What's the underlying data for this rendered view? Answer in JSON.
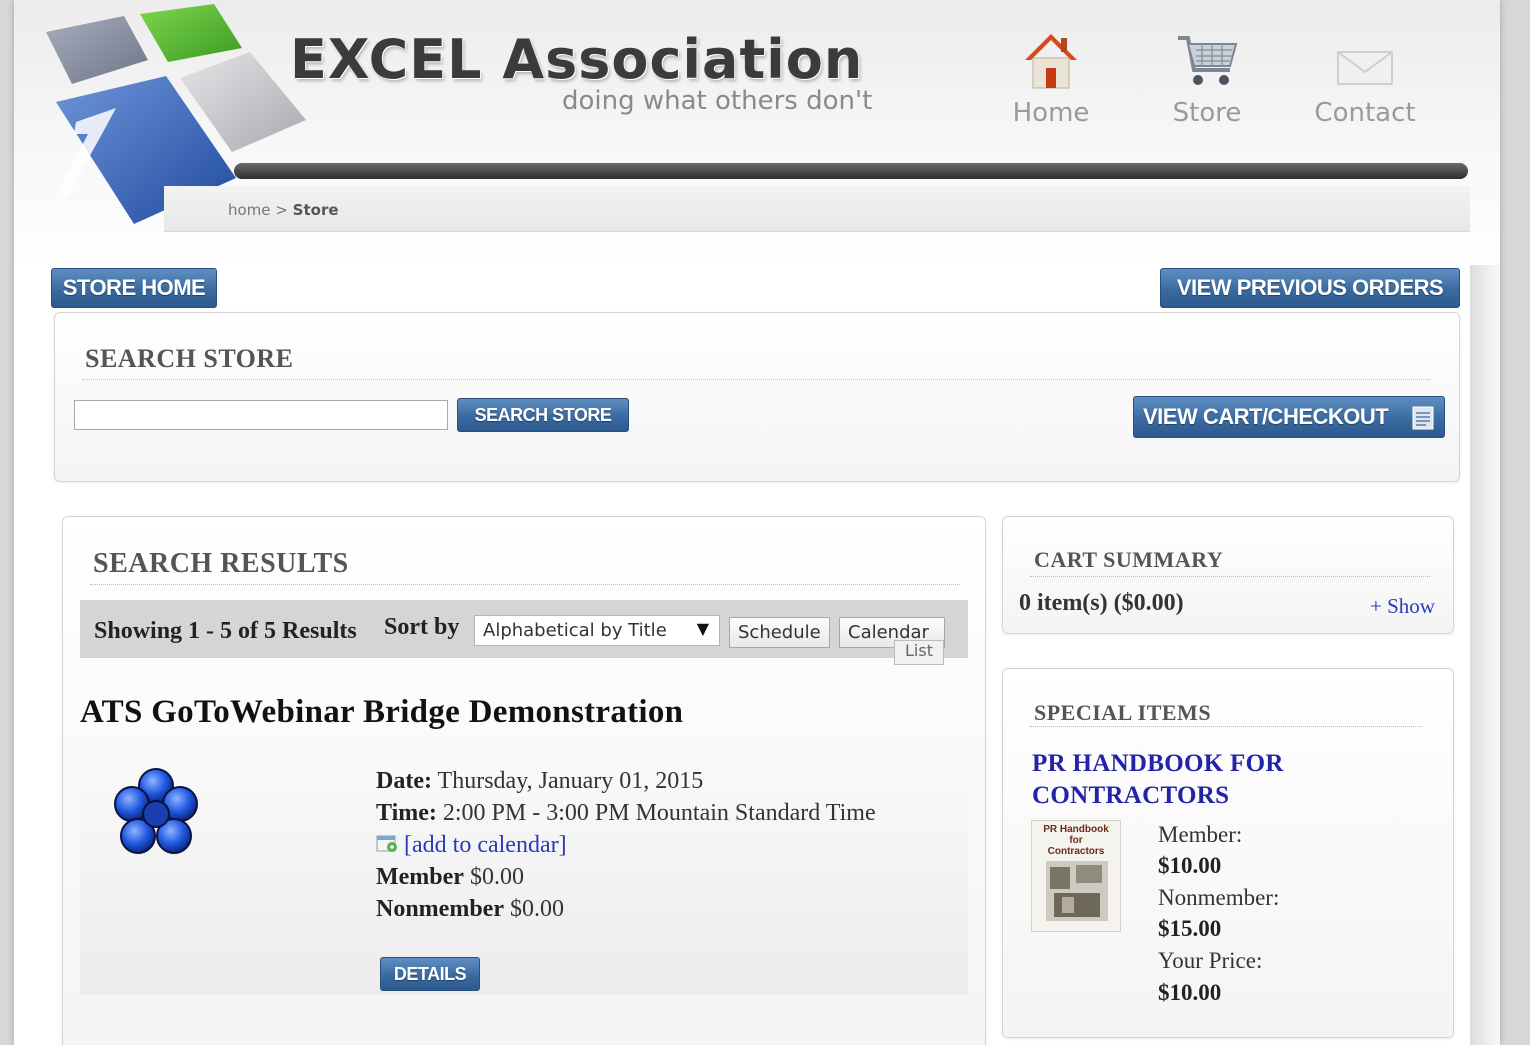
{
  "brand": {
    "name": "EXCEL Association",
    "tagline": "doing what others don't"
  },
  "nav": {
    "home": "Home",
    "store": "Store",
    "contact": "Contact"
  },
  "breadcrumb": {
    "home": "home",
    "separator": ">",
    "current": "Store"
  },
  "buttons": {
    "store_home": "STORE HOME",
    "view_previous_orders": "VIEW PREVIOUS ORDERS",
    "search_store": "SEARCH STORE",
    "view_cart": "VIEW CART/CHECKOUT",
    "details": "DETAILS"
  },
  "search": {
    "title": "SEARCH STORE",
    "value": "",
    "placeholder": ""
  },
  "results": {
    "title": "SEARCH RESULTS",
    "showing": "Showing 1 - 5 of 5 Results",
    "sort_label": "Sort by",
    "sort_selected": "Alphabetical by Title",
    "view_schedule": "Schedule",
    "view_calendar": "Calendar",
    "tooltip": "List"
  },
  "event": {
    "title": "ATS GoToWebinar Bridge Demonstration",
    "date_label": "Date:",
    "date_value": "Thursday, January 01, 2015",
    "time_label": "Time:",
    "time_value": "2:00 PM - 3:00 PM Mountain Standard Time",
    "add_calendar": "[add to calendar]",
    "member_label": "Member",
    "member_price": "$0.00",
    "nonmember_label": "Nonmember",
    "nonmember_price": "$0.00"
  },
  "cart": {
    "title": "CART SUMMARY",
    "summary": "0 item(s) ($0.00)",
    "show": "+ Show"
  },
  "special": {
    "title": "SPECIAL ITEMS",
    "item_title_1": "PR HANDBOOK FOR",
    "item_title_2": "CONTRACTORS",
    "member_label": "Member:",
    "member_price": "$10.00",
    "nonmember_label": "Nonmember:",
    "nonmember_price": "$15.00",
    "your_price_label": "Your Price:",
    "your_price": "$10.00",
    "book_cover_line1": "PR Handbook",
    "book_cover_line2": "for",
    "book_cover_line3": "Contractors"
  },
  "icons": {
    "home": "home-icon",
    "store": "cart-icon",
    "contact": "envelope-icon",
    "calendar": "calendar-icon",
    "cart_checkout": "cart-list-icon",
    "event": "gotowebinar-flower-icon"
  },
  "colors": {
    "button_blue": "#3a6aa0",
    "link_blue": "#2a39b8",
    "special_title": "#2323a8",
    "logo_green": "#56b52f",
    "logo_blue": "#3b66b5"
  }
}
